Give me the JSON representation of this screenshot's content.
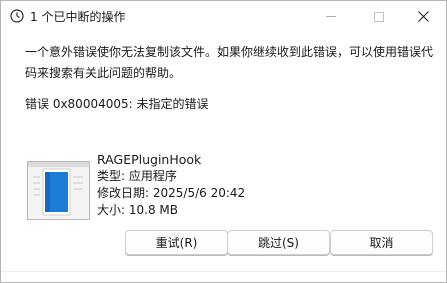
{
  "window": {
    "title": "1 个已中断的操作",
    "controls": {
      "minimize_icon": "minimize-icon",
      "maximize_icon": "maximize-icon",
      "close_icon": "close-icon"
    }
  },
  "dialog": {
    "message": "一个意外错误使你无法复制该文件。如果你继续收到此错误，可以使用错误代码来搜索有关此问题的帮助。",
    "error_code": "错误 0x80004005: 未指定的错误"
  },
  "file": {
    "name": "RAGEPluginHook",
    "type": "类型: 应用程序",
    "modified": "修改日期: 2025/5/6 20:42",
    "size": "大小: 10.8 MB",
    "icon": "application-file-icon"
  },
  "buttons": {
    "retry": "重试(R)",
    "skip": "跳过(S)",
    "cancel": "取消"
  },
  "colors": {
    "accent_blue": "#1e7bd8",
    "window_bg": "#ffffff",
    "border": "#cfcfcf"
  }
}
